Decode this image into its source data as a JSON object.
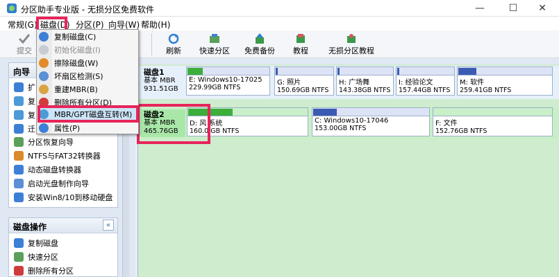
{
  "window": {
    "title": "分区助手专业版 - 无损分区免费软件",
    "minimize_glyph": "—",
    "maximize_glyph": "☐",
    "close_glyph": "✕"
  },
  "menubar": {
    "items": [
      {
        "label": "常规(G)"
      },
      {
        "label": "磁盘(D)"
      },
      {
        "label": "分区(P)"
      },
      {
        "label": "向导(W)"
      },
      {
        "label": "帮助(H)"
      }
    ]
  },
  "toolbar": {
    "submit": "提交",
    "buttons": [
      {
        "label": "刷新",
        "icon": "refresh-icon"
      },
      {
        "label": "快速分区",
        "icon": "quick-partition-icon"
      },
      {
        "label": "免费备份",
        "icon": "backup-icon"
      },
      {
        "label": "教程",
        "icon": "tutorial-icon"
      },
      {
        "label": "无损分区教程",
        "icon": "lossless-tutorial-icon"
      }
    ]
  },
  "disk_menu": {
    "items": [
      {
        "label": "复制磁盘(C)",
        "disabled": false,
        "color": "#3d7fd6"
      },
      {
        "label": "初始化磁盘(I)",
        "disabled": true,
        "color": "#9aa5b5"
      },
      {
        "label": "擦除磁盘(W)",
        "disabled": false,
        "color": "#e38a2a"
      },
      {
        "label": "坏扇区检测(S)",
        "disabled": false,
        "color": "#5b8fd6"
      },
      {
        "label": "重建MBR(B)",
        "disabled": false,
        "color": "#d9a441"
      },
      {
        "label": "删除所有分区(D)",
        "disabled": false,
        "color": "#d03b3b"
      },
      {
        "label": "MBR/GPT磁盘互转(M)",
        "disabled": false,
        "color": "#4b9bd6"
      },
      {
        "label": "属性(P)",
        "disabled": false,
        "color": "#3d7fd6"
      }
    ]
  },
  "left_panel": {
    "wizard_title": "向导",
    "wizard_items": [
      {
        "label": "扩",
        "color": "#3d7fd6"
      },
      {
        "label": "复",
        "color": "#4c9ad8"
      },
      {
        "label": "复",
        "color": "#4c9ad8"
      },
      {
        "label": "迁",
        "color": "#3d7fd6"
      },
      {
        "label": "分区恢复向导",
        "color": "#5aa05a"
      },
      {
        "label": "NTFS与FAT32转换器",
        "color": "#d98a2a"
      },
      {
        "label": "动态磁盘转换器",
        "color": "#3d7fd6"
      },
      {
        "label": "启动光盘制作向导",
        "color": "#5b8fd6"
      },
      {
        "label": "安装Win8/10到移动硬盘",
        "color": "#3d7fd6"
      }
    ],
    "disk_ops_title": "磁盘操作",
    "collapse_glyph": "«",
    "disk_ops_items": [
      {
        "label": "复制磁盘",
        "color": "#3d7fd6"
      },
      {
        "label": "快速分区",
        "color": "#5aa05a"
      },
      {
        "label": "删除所有分区",
        "color": "#d03b3b"
      }
    ]
  },
  "disks": [
    {
      "name": "磁盘1",
      "type": "基本 MBR",
      "size": "931.51GB",
      "selected": false,
      "partitions": [
        {
          "name": "E: Windows10-17025",
          "size": "229.99GB NTFS",
          "fill": 0.18
        },
        {
          "name": "G: 照片",
          "size": "150.69GB NTFS",
          "fill": 0.03
        },
        {
          "name": "H: 广场舞",
          "size": "143.38GB NTFS",
          "fill": 0.03
        },
        {
          "name": "I: 经验论文",
          "size": "157.44GB NTFS",
          "fill": 0.03
        },
        {
          "name": "M: 软件",
          "size": "259.41GB NTFS",
          "fill": 0.3
        }
      ]
    },
    {
      "name": "磁盘2",
      "type": "基本 MBR",
      "size": "465.76GB",
      "selected": true,
      "partitions": [
        {
          "name": "D: 风 系统",
          "size": "160.0 GB NTFS",
          "fill": 0.4
        },
        {
          "name": "C: Windows10-17046",
          "size": "153.00GB NTFS",
          "fill": 0.2
        },
        {
          "name": "F: 文件",
          "size": "152.76GB NTFS",
          "fill": 0.0
        }
      ]
    }
  ]
}
